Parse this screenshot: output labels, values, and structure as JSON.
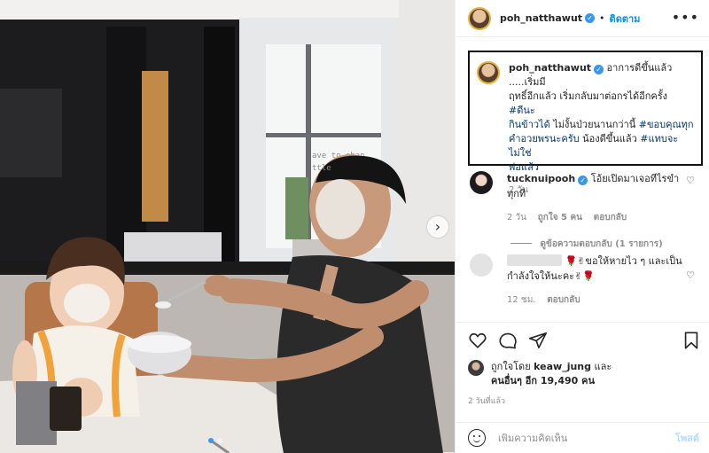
{
  "header": {
    "username": "poh_natthawut",
    "separator": "•",
    "follow_label": "ติดตาม",
    "more_icon": "more-horizontal-icon"
  },
  "caption": {
    "username": "poh_natthawut",
    "text_1": "อาการดีขึ้นแล้ว .....เริ่มมี",
    "text_2": "ฤทธิ์อีกแล้ว เริ่มกลับมาต่อกรได้อีกครั้ง",
    "hashtag_1": "#ดีนะ",
    "hashtag_1b": "กินข้าวได้",
    "text_3": "ไม่งั้นป่วยนานกว่านี้",
    "hashtag_2": "#ขอบคุณทุก",
    "hashtag_2b": "คำอวยพรนะครับ",
    "text_4": "น้องดีขึ้นแล้ว",
    "hashtag_3": "#แทบจะไม่ใช่",
    "hashtag_3b": "พ่อแล้ว",
    "time": "2 วัน"
  },
  "comments": [
    {
      "username": "tucknuipooh",
      "text_line1": "โอ้ยเปิดมาเจอทีไรขำ",
      "text_line2": "ทุกที",
      "time": "2 วัน",
      "likes": "ถูกใจ 5 คน",
      "reply_label": "ตอบกลับ"
    },
    {
      "username": "",
      "emoji_prefix": "🌹✌",
      "text_line1": "ขอให้หายไว ๆ และเป็น",
      "text_line2": "กำลังใจให้นะคะ",
      "emoji_suffix": "✌🌹",
      "time": "12 ชม.",
      "reply_label": "ตอบกลับ"
    }
  ],
  "view_replies": "ดูข้อความตอบกลับ (1 รายการ)",
  "actions": {
    "like_icon": "heart-icon",
    "comment_icon": "comment-icon",
    "share_icon": "share-icon",
    "save_icon": "bookmark-icon"
  },
  "likes": {
    "liked_by_prefix": "ถูกใจโดย",
    "liked_by_user": "keaw_jung",
    "and": "และ",
    "others_label": "คนอื่นๆ อีก 19,490 คน"
  },
  "date": "2 วันที่แล้ว",
  "comment_box": {
    "emoji_icon": "emoji-icon",
    "placeholder": "เพิ่มความคิดเห็น",
    "post_label": "โพสต์"
  },
  "carousel": {
    "next_icon": "chevron-right-icon",
    "total_slides": 2,
    "active_slide": 1
  },
  "photo": {
    "wall_text": "ave to chan",
    "wall_text_2": "ttle"
  }
}
